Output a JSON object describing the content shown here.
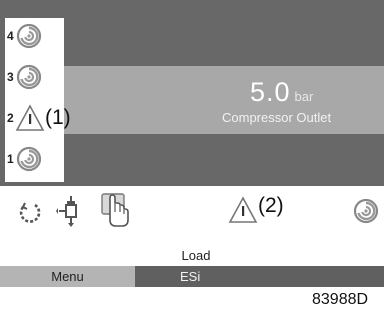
{
  "compressors": [
    {
      "number": "4",
      "icon": "compressor-swirl-icon",
      "callout": ""
    },
    {
      "number": "3",
      "icon": "compressor-swirl-icon",
      "callout": ""
    },
    {
      "number": "2",
      "icon": "warning-triangle-icon",
      "callout": "(1)"
    },
    {
      "number": "1",
      "icon": "compressor-swirl-icon",
      "callout": ""
    }
  ],
  "pressure": {
    "value": "5.0",
    "unit": "bar",
    "label": "Compressor Outlet"
  },
  "status_icons": {
    "items": [
      "power-cycle-icon",
      "valve-icon",
      "hand-touch-icon",
      "warning-triangle-icon",
      "compressor-swirl-icon"
    ],
    "warning_callout": "(2)"
  },
  "state": "Load",
  "menu": {
    "menu_label": "Menu",
    "esi_label": "ESi"
  },
  "figure_id": "83988D",
  "colors": {
    "top_band": "#686868",
    "mid_band": "#a8a8a8",
    "menu_tab": "#b4b4b4",
    "esi_tab": "#606060"
  }
}
